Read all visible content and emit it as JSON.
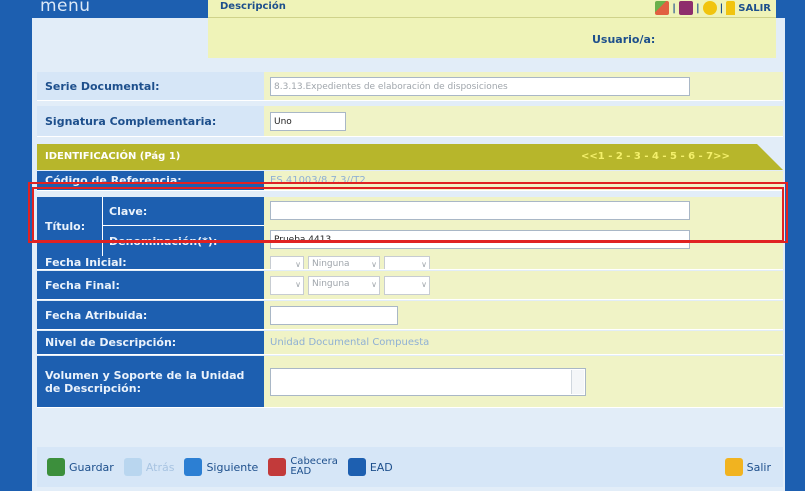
{
  "topbar": {
    "menu_label": "menu",
    "tab_label": "Descripción",
    "exit_label": "SALIR",
    "separator": "|"
  },
  "user": {
    "label": "Usuario/a:"
  },
  "form": {
    "serie_label": "Serie Documental:",
    "serie_value": "8.3.13.Expedientes de elaboración de disposiciones",
    "signatura_label": "Signatura Complementaria:",
    "signatura_value": "Uno",
    "section_title": "IDENTIFICACIÓN (Pág 1)",
    "pager": "<<1 - 2 - 3 - 4 - 5 - 6 - 7>>",
    "codigo_label": "Código de Referencia:",
    "codigo_value": "ES.41003/8.7.3//T2",
    "titulo_label": "Título:",
    "clave_label": "Clave:",
    "clave_value": "",
    "denominacion_label": "Denominación(*):",
    "denominacion_value": "Prueba 4413",
    "fecha_inicial_label": "Fecha Inicial:",
    "fecha_final_label": "Fecha Final:",
    "select_none": "Ninguna",
    "fecha_atribuida_label": "Fecha Atribuida:",
    "fecha_atribuida_value": "",
    "nivel_label": "Nivel de Descripción:",
    "nivel_value": "Unidad Documental Compuesta",
    "volumen_label": "Volumen y Soporte de la Unidad de Descripción:"
  },
  "buttons": {
    "guardar": "Guardar",
    "atras": "Atrás",
    "siguiente": "Siguiente",
    "cabecera_line1": "Cabecera",
    "cabecera_line2": "EAD",
    "ead": "EAD",
    "salir": "Salir"
  },
  "colors": {
    "primary_blue": "#1d5fb0",
    "section_olive": "#b7b62b",
    "highlight_red": "#e02222"
  }
}
